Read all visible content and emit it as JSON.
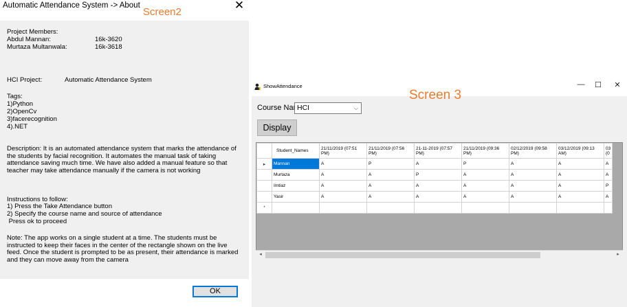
{
  "about": {
    "title": "Automatic Attendance System -> About",
    "screen_tag": "Screen2",
    "close_glyph": "✕",
    "members_heading": "Project Members:",
    "members": [
      {
        "name": "Abdul Mannan:",
        "id": "16k-3620"
      },
      {
        "name": "Murtaza Multanwala:",
        "id": "16k-3618"
      }
    ],
    "project_label": "HCI Project:",
    "project_value": "Automatic Attendance System",
    "tags_heading": "Tags:",
    "tags": [
      "1)Python",
      "2)OpenCv",
      "3)facerecognition",
      "4).NET"
    ],
    "description": "Description: It is an automated attendance system that marks the attendance of the students by facial recognition. It automates the manual task of taking attendance saving much time. We have also added a manual feature so that teacher may take attendance manually if the camera is not working",
    "instructions": [
      "Instructions to follow:",
      "1) Press the Take Attendance button",
      "2) Specify the course name and source of attendance",
      " Press ok to proceed"
    ],
    "note": "Note: The app works on a single student at a time. The students must be instructed to keep their faces in the center of the rectangle shown on the live feed. Once the student is prompted to be as present, their attendance is marked and they can move away from the camera",
    "ok_label": "OK"
  },
  "show_attendance": {
    "title": "ShowAttendance",
    "screen_tag": "Screen 3",
    "window_controls": {
      "minimize": "—",
      "maximize": "☐",
      "close": "✕"
    },
    "course_label": "Course Name",
    "course_value": "HCI",
    "display_label": "Display",
    "grid": {
      "columns": [
        "Student_Names",
        "21/11/2019 (07:51 PM)",
        "21/11/2019 (07:56 PM)",
        "21-11-2019 (07:57 PM)",
        "21/11/2019 (09:36 PM)",
        "02/12/2019 (09:58 PM)",
        "03/12/2019 (09:13 AM)",
        "03 (0"
      ],
      "rows": [
        {
          "marker": "▸",
          "cells": [
            "Mannan",
            "A",
            "P",
            "A",
            "P",
            "A",
            "A",
            "A"
          ]
        },
        {
          "marker": "",
          "cells": [
            "Murtaza",
            "A",
            "A",
            "P",
            "A",
            "A",
            "A",
            "A"
          ]
        },
        {
          "marker": "",
          "cells": [
            "Imtiaz",
            "A",
            "A",
            "A",
            "A",
            "A",
            "A",
            "P"
          ]
        },
        {
          "marker": "",
          "cells": [
            "Yasir",
            "A",
            "A",
            "A",
            "A",
            "A",
            "A",
            "A"
          ]
        },
        {
          "marker": "*",
          "cells": [
            "",
            "",
            "",
            "",
            "",
            "",
            "",
            ""
          ]
        }
      ]
    },
    "scroll": {
      "left": "◂",
      "right": "▸"
    }
  }
}
